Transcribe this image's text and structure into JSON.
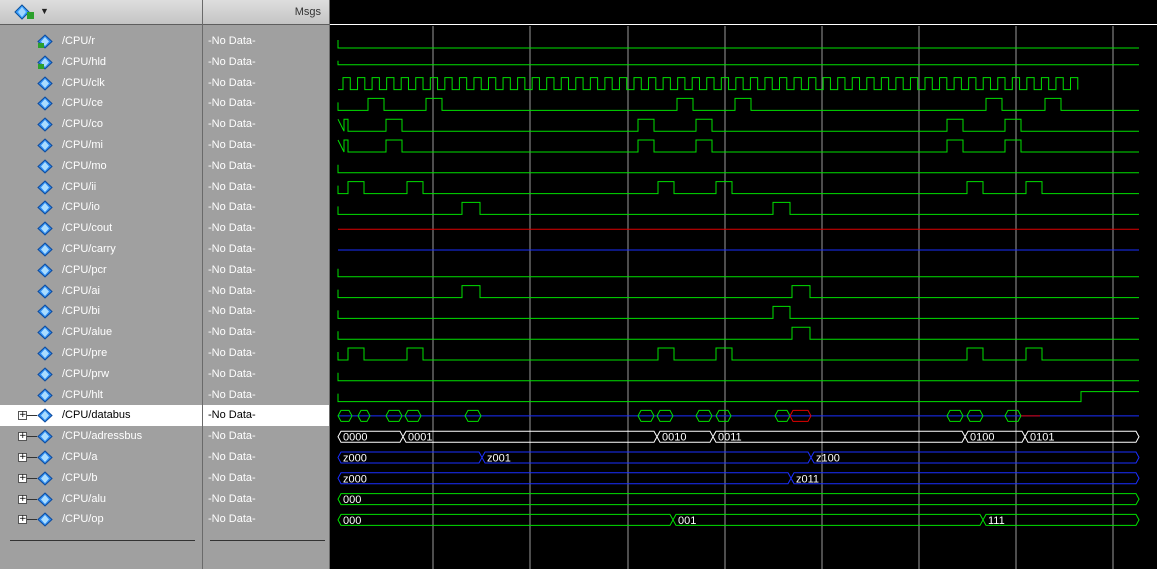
{
  "header": {
    "msgs_label": "Msgs"
  },
  "colors": {
    "green": "#00e000",
    "red": "#e00000",
    "blue": "#1a2fff",
    "grid": "#9a9a9a",
    "white": "#ffffff"
  },
  "signals": [
    {
      "name": "/CPU/r",
      "value": "-No Data-",
      "icon": "pin-in-icon",
      "expand": false
    },
    {
      "name": "/CPU/hld",
      "value": "-No Data-",
      "icon": "pin-in-icon",
      "expand": false
    },
    {
      "name": "/CPU/clk",
      "value": "-No Data-",
      "icon": "signal-diamond-icon",
      "expand": false
    },
    {
      "name": "/CPU/ce",
      "value": "-No Data-",
      "icon": "signal-diamond-icon",
      "expand": false
    },
    {
      "name": "/CPU/co",
      "value": "-No Data-",
      "icon": "signal-diamond-icon",
      "expand": false
    },
    {
      "name": "/CPU/mi",
      "value": "-No Data-",
      "icon": "signal-diamond-icon",
      "expand": false
    },
    {
      "name": "/CPU/mo",
      "value": "-No Data-",
      "icon": "signal-diamond-icon",
      "expand": false
    },
    {
      "name": "/CPU/ii",
      "value": "-No Data-",
      "icon": "signal-diamond-icon",
      "expand": false
    },
    {
      "name": "/CPU/io",
      "value": "-No Data-",
      "icon": "signal-diamond-icon",
      "expand": false
    },
    {
      "name": "/CPU/cout",
      "value": "-No Data-",
      "icon": "signal-diamond-icon",
      "expand": false
    },
    {
      "name": "/CPU/carry",
      "value": "-No Data-",
      "icon": "signal-diamond-icon",
      "expand": false
    },
    {
      "name": "/CPU/pcr",
      "value": "-No Data-",
      "icon": "signal-diamond-icon",
      "expand": false
    },
    {
      "name": "/CPU/ai",
      "value": "-No Data-",
      "icon": "signal-diamond-icon",
      "expand": false
    },
    {
      "name": "/CPU/bi",
      "value": "-No Data-",
      "icon": "signal-diamond-icon",
      "expand": false
    },
    {
      "name": "/CPU/alue",
      "value": "-No Data-",
      "icon": "signal-diamond-icon",
      "expand": false
    },
    {
      "name": "/CPU/pre",
      "value": "-No Data-",
      "icon": "signal-diamond-icon",
      "expand": false
    },
    {
      "name": "/CPU/prw",
      "value": "-No Data-",
      "icon": "signal-diamond-icon",
      "expand": false
    },
    {
      "name": "/CPU/hlt",
      "value": "-No Data-",
      "icon": "signal-diamond-icon",
      "expand": false
    },
    {
      "name": "/CPU/databus",
      "value": "-No Data-",
      "icon": "signal-diamond-icon",
      "expand": true,
      "selected": true
    },
    {
      "name": "/CPU/adressbus",
      "value": "-No Data-",
      "icon": "signal-diamond-icon",
      "expand": true
    },
    {
      "name": "/CPU/a",
      "value": "-No Data-",
      "icon": "signal-diamond-icon",
      "expand": true
    },
    {
      "name": "/CPU/b",
      "value": "-No Data-",
      "icon": "signal-diamond-icon",
      "expand": true
    },
    {
      "name": "/CPU/alu",
      "value": "-No Data-",
      "icon": "signal-diamond-icon",
      "expand": true
    },
    {
      "name": "/CPU/op",
      "value": "-No Data-",
      "icon": "signal-diamond-icon",
      "expand": true
    }
  ],
  "bus_labels": {
    "adressbus": [
      "0000",
      "0001",
      "0010",
      "0011",
      "0100",
      "0101"
    ],
    "a": [
      "z000",
      "z001",
      "z100"
    ],
    "b": [
      "z000",
      "z011"
    ],
    "alu": [
      "000"
    ],
    "op": [
      "000",
      "001",
      "111"
    ]
  }
}
